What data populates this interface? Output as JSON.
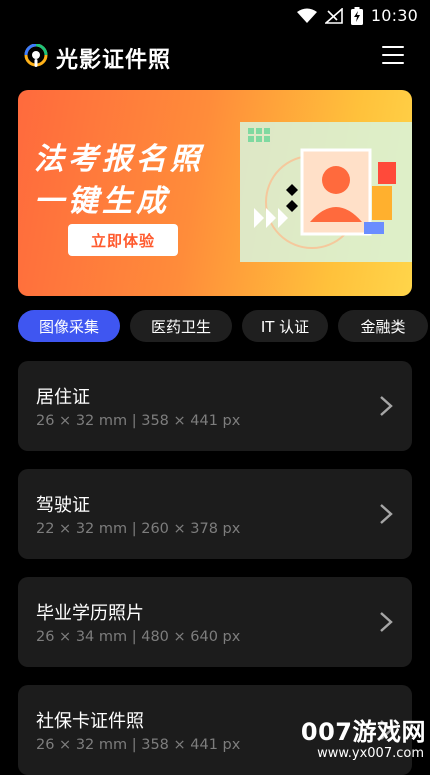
{
  "status": {
    "time": "10:30"
  },
  "app": {
    "title": "光影证件照"
  },
  "banner": {
    "line1": "法考报名照",
    "line2": "一键生成",
    "button": "立即体验"
  },
  "tabs": [
    {
      "label": "图像采集"
    },
    {
      "label": "医药卫生"
    },
    {
      "label": "IT 认证"
    },
    {
      "label": "金融类"
    }
  ],
  "cards": [
    {
      "title": "居住证",
      "sub": "26 × 32 mm | 358 × 441 px"
    },
    {
      "title": "驾驶证",
      "sub": "22 × 32 mm | 260 × 378 px"
    },
    {
      "title": "毕业学历照片",
      "sub": "26 × 34 mm | 480 × 640 px"
    },
    {
      "title": "社保卡证件照",
      "sub": "26 × 32 mm | 358 × 441 px"
    }
  ],
  "watermark": {
    "text": "007游戏网",
    "url": "www.yx007.com"
  },
  "colors": {
    "accent": "#3f56f1",
    "card": "#1c1c1c",
    "background": "#000000"
  }
}
